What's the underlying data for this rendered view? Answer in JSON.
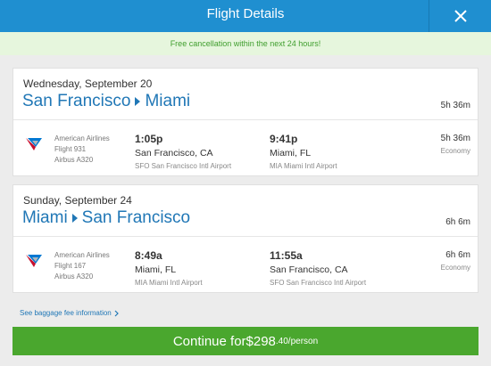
{
  "header": {
    "title": "Flight Details"
  },
  "notice": {
    "text": "Free cancellation within the next 24 hours!"
  },
  "flights": [
    {
      "date": "Wednesday, September 20",
      "origin": "San Francisco",
      "destination": "Miami",
      "total_duration": "5h 36m",
      "segment": {
        "airline": "American Airlines",
        "flight": "Flight 931",
        "aircraft": "Airbus A320",
        "dep_time": "1:05p",
        "dep_city": "San Francisco, CA",
        "dep_airport": "SFO San Francisco Intl Airport",
        "arr_time": "9:41p",
        "arr_city": "Miami, FL",
        "arr_airport": "MIA Miami Intl Airport",
        "duration": "5h 36m",
        "cabin": "Economy"
      }
    },
    {
      "date": "Sunday, September 24",
      "origin": "Miami",
      "destination": "San Francisco",
      "total_duration": "6h 6m",
      "segment": {
        "airline": "American Airlines",
        "flight": "Flight 167",
        "aircraft": "Airbus A320",
        "dep_time": "8:49a",
        "dep_city": "Miami, FL",
        "dep_airport": "MIA Miami Intl Airport",
        "arr_time": "11:55a",
        "arr_city": "San Francisco, CA",
        "arr_airport": "SFO San Francisco Intl Airport",
        "duration": "6h 6m",
        "cabin": "Economy"
      }
    }
  ],
  "baggage": {
    "link_text": "See baggage fee information"
  },
  "continue": {
    "prefix": "Continue for ",
    "price_main": "$298",
    "price_small": ".40/person"
  },
  "icons": {
    "close": "close-icon",
    "airline_logo": "american-airlines-logo-icon",
    "chevron": "chevron-right-icon",
    "route_arrow": "arrow-right-icon"
  },
  "colors": {
    "header": "#1f8fd0",
    "accent_blue": "#2077b6",
    "notice_bg": "#e6f6dd",
    "notice_text": "#3f9e2d",
    "continue_bg": "#4aa72e"
  }
}
